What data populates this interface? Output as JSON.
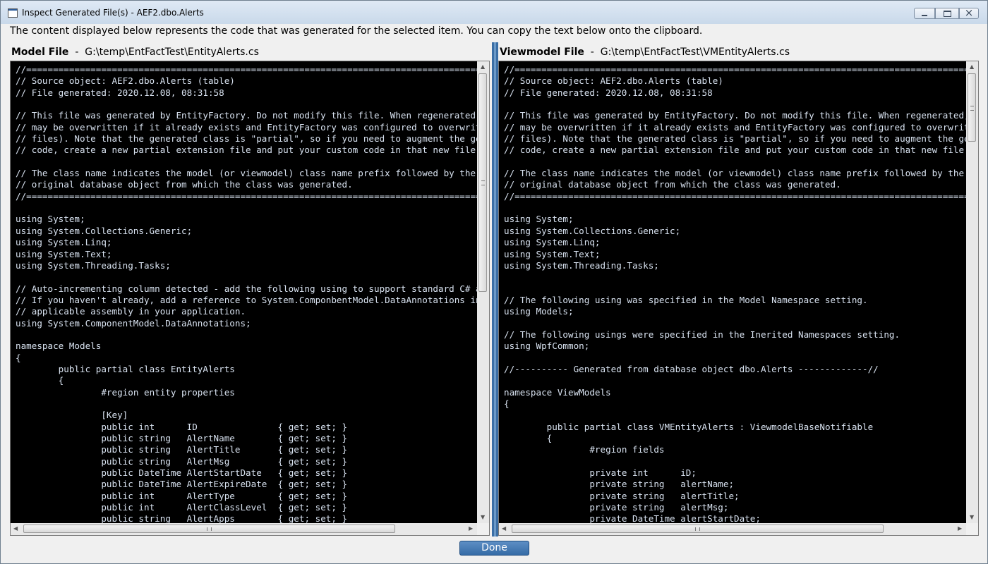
{
  "window": {
    "title": "Inspect Generated File(s) - AEF2.dbo.Alerts"
  },
  "description": "The content displayed below represents the code that was generated for the selected item. You can copy the text below onto the clipboard.",
  "model_pane": {
    "label": "Model File",
    "separator": "-",
    "path": "G:\\temp\\EntFactTest\\EntityAlerts.cs",
    "code": "//==================================================================================================\n// Source object: AEF2.dbo.Alerts (table)\n// File generated: 2020.12.08, 08:31:58\n\n// This file was generated by EntityFactory. Do not modify this file. When regenerated, this file\n// may be overwritten if it already exists and EntityFactory was configured to overwrite existing\n// files). Note that the generated class is \"partial\", so if you need to augment the generated\n// code, create a new partial extension file and put your custom code in that new file.\n\n// The class name indicates the model (or viewmodel) class name prefix followed by the name of the\n// original database object from which the class was generated.\n//==================================================================================================\n\nusing System;\nusing System.Collections.Generic;\nusing System.Linq;\nusing System.Text;\nusing System.Threading.Tasks;\n\n// Auto-incrementing column detected - add the following using to support standard C# attributes.\n// If you haven't already, add a reference to System.ComponbentModel.DataAnnotations in your\n// applicable assembly in your application.\nusing System.ComponentModel.DataAnnotations;\n\nnamespace Models\n{\n\tpublic partial class EntityAlerts\n\t{\n\t\t#region entity properties\n\n\t\t[Key]\n\t\tpublic int      ID               { get; set; }\n\t\tpublic string   AlertName        { get; set; }\n\t\tpublic string   AlertTitle       { get; set; }\n\t\tpublic string   AlertMsg         { get; set; }\n\t\tpublic DateTime AlertStartDate   { get; set; }\n\t\tpublic DateTime AlertExpireDate  { get; set; }\n\t\tpublic int      AlertType        { get; set; }\n\t\tpublic int      AlertClassLevel  { get; set; }\n\t\tpublic string   AlertApps        { get; set; }"
  },
  "viewmodel_pane": {
    "label": "Viewmodel File",
    "separator": "-",
    "path": "G:\\temp\\EntFactTest\\VMEntityAlerts.cs",
    "code": "//==================================================================================================\n// Source object: AEF2.dbo.Alerts (table)\n// File generated: 2020.12.08, 08:31:58\n\n// This file was generated by EntityFactory. Do not modify this file. When regenerated, this file\n// may be overwritten if it already exists and EntityFactory was configured to overwrite existing\n// files). Note that the generated class is \"partial\", so if you need to augment the generated\n// code, create a new partial extension file and put your custom code in that new file.\n\n// The class name indicates the model (or viewmodel) class name prefix followed by the name of the\n// original database object from which the class was generated.\n//==================================================================================================\n\nusing System;\nusing System.Collections.Generic;\nusing System.Linq;\nusing System.Text;\nusing System.Threading.Tasks;\n\n\n// The following using was specified in the Model Namespace setting.\nusing Models;\n\n// The following usings were specified in the Inerited Namespaces setting.\nusing WpfCommon;\n\n//---------- Generated from database object dbo.Alerts -------------//\n\nnamespace ViewModels\n{\n\n\tpublic partial class VMEntityAlerts : ViewmodelBaseNotifiable\n\t{\n\t\t#region fields\n\n\t\tprivate int      iD;\n\t\tprivate string   alertName;\n\t\tprivate string   alertTitle;\n\t\tprivate string   alertMsg;\n\t\tprivate DateTime alertStartDate;"
  },
  "buttons": {
    "done": "Done"
  },
  "icons": {
    "app": "window-app-icon",
    "minimize": "minimize-icon",
    "maximize": "maximize-icon",
    "close": "close-icon"
  },
  "colors": {
    "code_background": "#000000",
    "code_text": "#d8e2f0",
    "accent": "#3a6ea5"
  }
}
